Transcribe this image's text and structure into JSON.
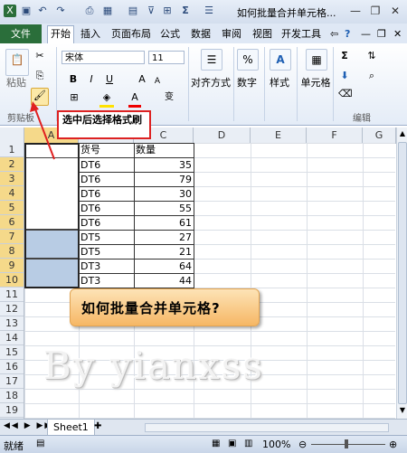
{
  "window": {
    "title": "如何批量合并单元格...",
    "minimize": "—",
    "restore": "❐",
    "close": "✕"
  },
  "quick_access": [
    "save-icon",
    "undo-icon",
    "redo-icon",
    "print-preview-icon",
    "borders-icon",
    "sum-icon",
    "align-icon"
  ],
  "ribbon_tabs": [
    {
      "label": "文件"
    },
    {
      "label": "开始"
    },
    {
      "label": "插入"
    },
    {
      "label": "页面布局"
    },
    {
      "label": "公式"
    },
    {
      "label": "数据"
    },
    {
      "label": "审阅"
    },
    {
      "label": "视图"
    },
    {
      "label": "开发工具"
    }
  ],
  "ribbon": {
    "clipboard": {
      "paste": "粘贴",
      "group": "剪贴板"
    },
    "font": {
      "name": "宋体",
      "size": "11",
      "bold": "B",
      "italic": "I",
      "underline": "U",
      "grow": "A",
      "shrink": "A",
      "font_color": "A",
      "phonetic": "变"
    },
    "alignment": {
      "label": "对齐方式"
    },
    "number": {
      "label": "数字",
      "percent": "%"
    },
    "styles": {
      "label": "样式"
    },
    "cells": {
      "label": "单元格"
    },
    "editing": {
      "label": "编辑",
      "sum": "Σ"
    }
  },
  "note": "选中后选择格式刷",
  "columns": [
    "A",
    "B",
    "C",
    "D",
    "E",
    "F",
    "G"
  ],
  "rows": [
    "1",
    "2",
    "3",
    "4",
    "5",
    "6",
    "7",
    "8",
    "9",
    "10",
    "11",
    "12",
    "13",
    "14",
    "15",
    "16",
    "17",
    "18",
    "19"
  ],
  "header_b": "货号",
  "header_c": "数量",
  "data": [
    {
      "code": "DT6",
      "qty": "35"
    },
    {
      "code": "DT6",
      "qty": "79"
    },
    {
      "code": "DT6",
      "qty": "30"
    },
    {
      "code": "DT6",
      "qty": "55"
    },
    {
      "code": "DT6",
      "qty": "61"
    },
    {
      "code": "DT5",
      "qty": "27"
    },
    {
      "code": "DT5",
      "qty": "21"
    },
    {
      "code": "DT3",
      "qty": "64"
    },
    {
      "code": "DT3",
      "qty": "44"
    }
  ],
  "callout": "如何批量合并单元格?",
  "watermark": "By yianxss",
  "sheet_tab": "Sheet1",
  "status": {
    "ready": "就绪",
    "zoom": "100%"
  }
}
